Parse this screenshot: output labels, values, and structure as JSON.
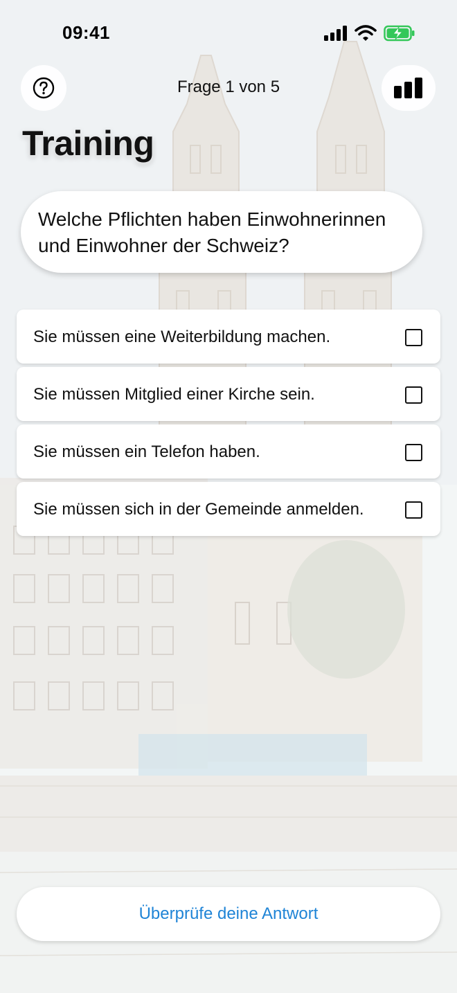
{
  "status_bar": {
    "time": "09:41",
    "icons": [
      "signal-icon",
      "wifi-icon",
      "battery-charging-icon"
    ]
  },
  "nav": {
    "title": "Frage 1 von 5",
    "left_icon": "help-circle-icon",
    "right_icon": "bar-chart-icon"
  },
  "page": {
    "title": "Training"
  },
  "question": {
    "text": "Welche Pflichten haben Einwohnerinnen und Einwohner der Schweiz?"
  },
  "answers": [
    {
      "text": "Sie müssen eine Weiterbildung machen.",
      "checked": false
    },
    {
      "text": "Sie müssen Mitglied einer Kirche sein.",
      "checked": false
    },
    {
      "text": "Sie müssen ein Telefon haben.",
      "checked": false
    },
    {
      "text": "Sie müssen sich in der Gemeinde anmelden.",
      "checked": false
    }
  ],
  "actions": {
    "check_label": "Überprüfe deine Antwort"
  },
  "colors": {
    "accent": "#1f84d6",
    "battery": "#34c759"
  }
}
